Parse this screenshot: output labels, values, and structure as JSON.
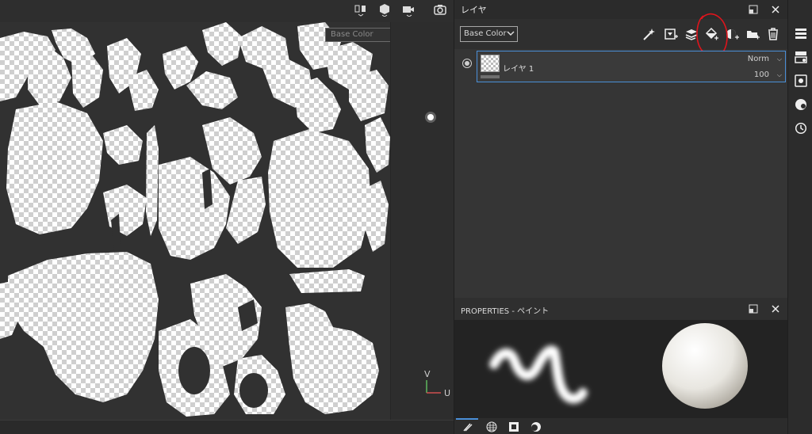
{
  "viewport": {
    "channel_select": "Base Color",
    "axis_v": "V",
    "axis_u": "U",
    "toolbar_icons": [
      "projection-icon",
      "cube-icon",
      "camera-icon",
      "screenshot-icon"
    ]
  },
  "layer_panel": {
    "title": "レイヤ",
    "channel_select": "Base Color",
    "toolbar_icons": [
      "magic-wand-icon",
      "add-mask-icon",
      "add-layer-stack-icon",
      "add-fill-layer-icon",
      "add-effect-icon",
      "add-folder-icon",
      "delete-icon"
    ],
    "annotation_color": "#e0141c",
    "layers": [
      {
        "name": "レイヤ 1",
        "blend_mode": "Norm",
        "opacity": "100"
      }
    ]
  },
  "properties": {
    "title": "PROPERTIES - ペイント",
    "tabs": [
      "brush-icon",
      "material-icon",
      "stencil-icon",
      "alpha-icon"
    ]
  },
  "sidebar": {
    "icons": [
      "layers-panel-icon",
      "texture-set-icon",
      "display-settings-icon",
      "shader-settings-icon",
      "history-icon"
    ]
  },
  "colors": {
    "accent": "#4a8fd8",
    "panel_bg": "#353535",
    "viewport_bg": "#2e2e2e"
  }
}
